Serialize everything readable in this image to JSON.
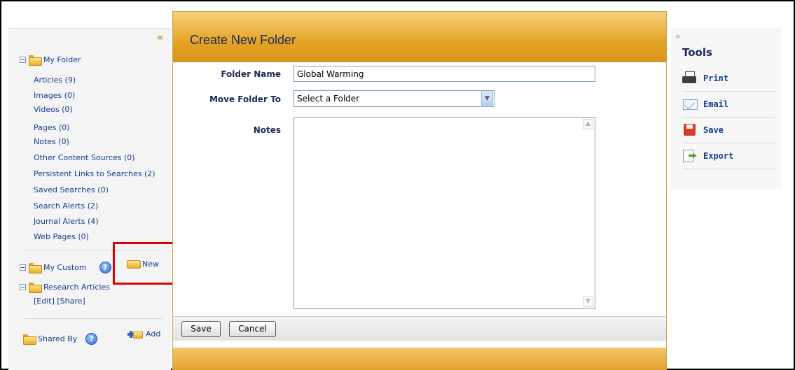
{
  "sidebar": {
    "collapse_glyph": "«",
    "my_folder": "My Folder",
    "items": [
      {
        "label": "Articles",
        "count": "(9)"
      },
      {
        "label": "Images",
        "count": "(0)"
      },
      {
        "label": "Videos",
        "count": "(0)"
      },
      {
        "label": "Pages",
        "count": "(0)"
      },
      {
        "label": "Notes",
        "count": "(0)"
      },
      {
        "label": "Other Content Sources",
        "count": "(0)"
      },
      {
        "label": "Persistent Links to Searches",
        "count": "(2)"
      },
      {
        "label": "Saved Searches",
        "count": "(0)"
      },
      {
        "label": "Search Alerts",
        "count": "(2)"
      },
      {
        "label": "Journal Alerts",
        "count": "(4)"
      },
      {
        "label": "Web Pages",
        "count": "(0)"
      }
    ],
    "my_custom": "My Custom",
    "new_label": "New",
    "research_articles": "Research Articles",
    "edit_label": "[Edit]",
    "share_label": "[Share]",
    "shared_by": "Shared By",
    "add_label": "Add",
    "help_glyph": "?"
  },
  "modal": {
    "title": "Create New Folder",
    "folder_name_label": "Folder Name",
    "folder_name_value": "Global Warming",
    "move_folder_label": "Move Folder To",
    "move_folder_value": "Select a Folder",
    "notes_label": "Notes",
    "save_label": "Save",
    "cancel_label": "Cancel"
  },
  "tools": {
    "collapse_glyph": "»",
    "title": "Tools",
    "items": [
      {
        "label": "Print",
        "icon": "print-icon"
      },
      {
        "label": "Email",
        "icon": "email-icon"
      },
      {
        "label": "Save",
        "icon": "save-icon"
      },
      {
        "label": "Export",
        "icon": "export-icon"
      }
    ]
  },
  "colors": {
    "header_gold": "#e4a326",
    "link_blue": "#1a3d8f",
    "highlight_red": "#e00000"
  }
}
